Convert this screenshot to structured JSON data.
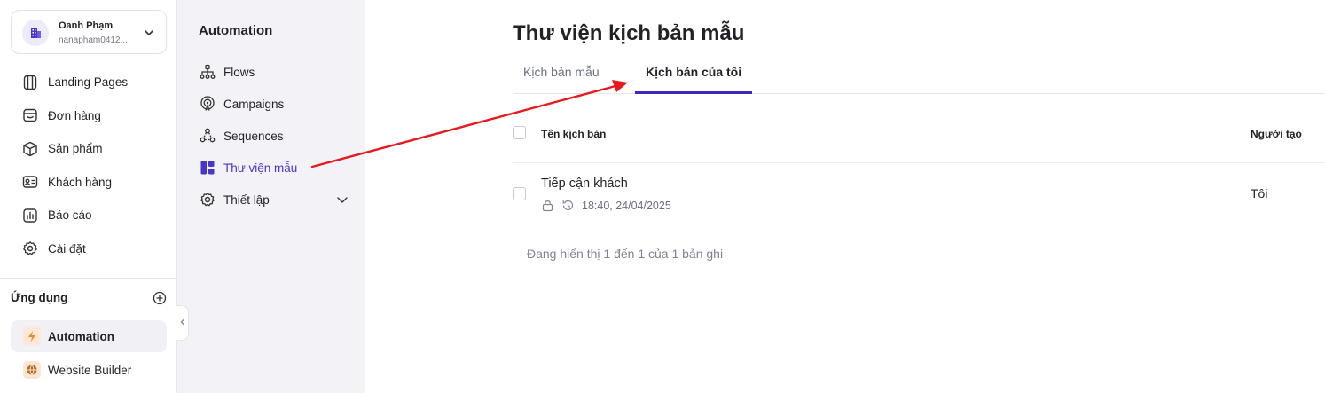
{
  "account": {
    "name": "Oanh Phạm",
    "email": "nanapham0412..."
  },
  "sidebar": {
    "items": [
      {
        "label": "Landing Pages",
        "icon": "landing-pages-icon"
      },
      {
        "label": "Đơn hàng",
        "icon": "orders-icon"
      },
      {
        "label": "Sản phẩm",
        "icon": "box-icon"
      },
      {
        "label": "Khách hàng",
        "icon": "contact-card-icon"
      },
      {
        "label": "Báo cáo",
        "icon": "bar-chart-icon"
      },
      {
        "label": "Cài đặt",
        "icon": "gear-icon"
      }
    ],
    "apps_label": "Ứng dụng",
    "apps": [
      {
        "label": "Automation",
        "icon": "lightning-icon",
        "active": true
      },
      {
        "label": "Website Builder",
        "icon": "globe-icon",
        "active": false
      }
    ]
  },
  "subnav": {
    "title": "Automation",
    "items": [
      {
        "label": "Flows",
        "icon": "flow-icon"
      },
      {
        "label": "Campaigns",
        "icon": "broadcast-icon"
      },
      {
        "label": "Sequences",
        "icon": "sequence-icon"
      },
      {
        "label": "Thư viện mẫu",
        "icon": "library-icon",
        "active": true
      },
      {
        "label": "Thiết lập",
        "icon": "gear-icon"
      }
    ]
  },
  "main": {
    "title": "Thư viện kịch bản mẫu",
    "tabs": [
      {
        "label": "Kịch bản mẫu",
        "active": false
      },
      {
        "label": "Kịch bản của tôi",
        "active": true
      }
    ],
    "columns": [
      "Tên kịch bản",
      "Người tạo"
    ],
    "rows": [
      {
        "name": "Tiếp cận khách",
        "time": "18:40, 24/04/2025",
        "creator": "Tôi"
      }
    ],
    "footer": "Đang hiển thị 1 đến 1 của 1 bản ghi"
  },
  "colors": {
    "accent": "#3a2bb8",
    "active_link": "#4a35c9",
    "subnav_bg": "#f3f2f6",
    "annotation_arrow": "#e8191c"
  }
}
